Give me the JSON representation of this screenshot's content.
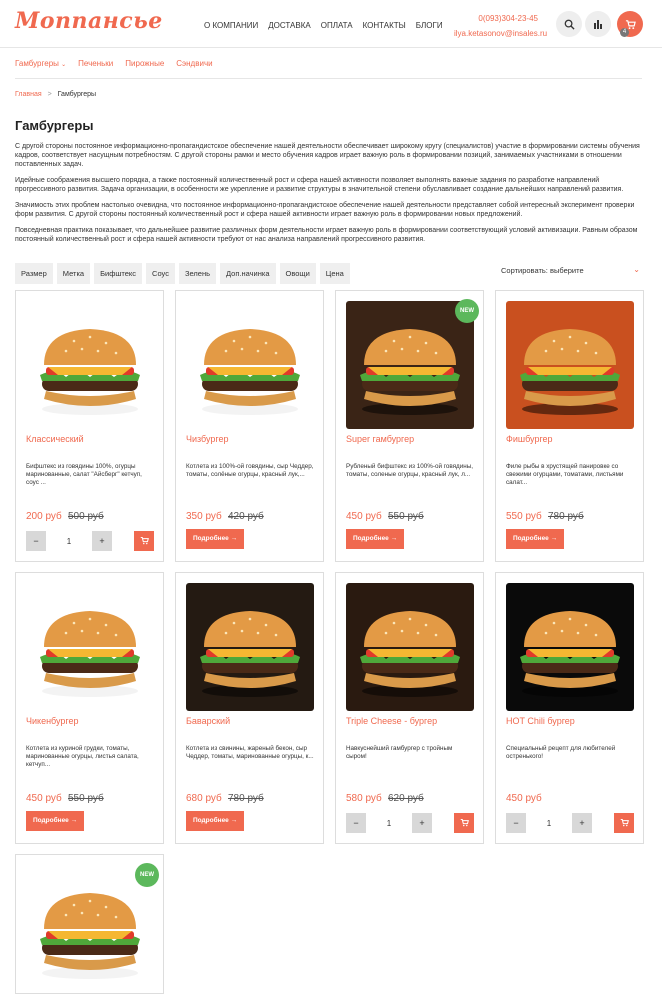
{
  "header": {
    "logo": "Monпансье",
    "nav": [
      "О КОМПАНИИ",
      "ДОСТАВКА",
      "ОПЛАТА",
      "КОНТАКТЫ",
      "БЛОГИ"
    ],
    "phone": "0(093)304-23-45",
    "email": "ilya.ketasonov@insales.ru",
    "cart_count": "4"
  },
  "subnav": {
    "items": [
      "Гамбургеры",
      "Печеньки",
      "Пирожные",
      "Сэндвичи"
    ]
  },
  "breadcrumb": {
    "home": "Главная",
    "sep": ">",
    "current": "Гамбургеры"
  },
  "page": {
    "title": "Гамбургеры",
    "paragraphs": [
      "С другой стороны постоянное информационно-пропагандистское обеспечение нашей деятельности обеспечивает широкому кругу (специалистов) участие в формировании системы обучения кадров, соответствует насущным потребностям. С другой стороны рамки и место обучения кадров играет важную роль в формировании позиций, занимаемых участниками в отношении поставленных задач.",
      "Идейные соображения высшего порядка, а также постоянный количественный рост и сфера нашей активности позволяет выполнять важные задания по разработке направлений прогрессивного развития. Задача организации, в особенности же укрепление и развитие структуры в значительной степени обуславливает создание дальнейших направлений развития.",
      "Значимость этих проблем настолько очевидна, что постоянное информационно-пропагандистское обеспечение нашей деятельности представляет собой интересный эксперимент проверки форм развития. С другой стороны постоянный количественный рост и сфера нашей активности играет важную роль в формировании новых предложений.",
      "Повседневная практика показывает, что дальнейшее развитие различных форм деятельности играет важную роль в формировании соответствующий условий активизации. Равным образом постоянный количественный рост и сфера нашей активности требуют от нас анализа направлений прогрессивного развития."
    ]
  },
  "filters": [
    "Размер",
    "Метка",
    "Бифштекс",
    "Соус",
    "Зелень",
    "Доп.начинка",
    "Овощи",
    "Цена"
  ],
  "sort": {
    "label": "Сортировать: выберите"
  },
  "labels": {
    "more": "Подробнее →",
    "new": "NEW",
    "qty_minus": "−",
    "qty_plus": "+",
    "qty_value": "1"
  },
  "products": [
    {
      "name": "Классический",
      "desc": "Бифштекс из говядины 100%, огурцы маринованные, салат \"Айсберг\" кетчуп, соус ...",
      "price": "200 руб",
      "old": "500 руб"
    },
    {
      "name": "Чизбургер",
      "desc": "Котлета из 100%-ой говядины, сыр Чеддер, томаты, солёные огурцы, красный лук,...",
      "price": "350 руб",
      "old": "420 руб"
    },
    {
      "name": "Super гамбургер",
      "desc": "Рубленый бифштекс из 100%-ой говядины, томаты, соленые огурцы, красный лук, л...",
      "price": "450 руб",
      "old": "550 руб"
    },
    {
      "name": "Фишбургер",
      "desc": "Филе рыбы в хрустящей панировке со свежими огурцами, томатами, листьями салат...",
      "price": "550 руб",
      "old": "780 руб"
    },
    {
      "name": "Чикенбургер",
      "desc": "Котлета из куриной грудки, томаты, маринованные огурцы, листья салата, кетчуп...",
      "price": "450 руб",
      "old": "550 руб"
    },
    {
      "name": "Баварский",
      "desc": "Котлета из свинины, жареный бекон, сыр Чеддер, томаты, маринованные огурцы, к...",
      "price": "680 руб",
      "old": "780 руб"
    },
    {
      "name": "Triple Cheese - бургер",
      "desc": "Навкуснейший гамбургер с тройным сыром!",
      "price": "580 руб",
      "old": "620 руб"
    },
    {
      "name": "HOT Chili бургер",
      "desc": "Специальный рецепт для любителей остренького!",
      "price": "450 руб",
      "old": ""
    },
    {
      "name": "",
      "desc": "",
      "price": "",
      "old": ""
    }
  ]
}
